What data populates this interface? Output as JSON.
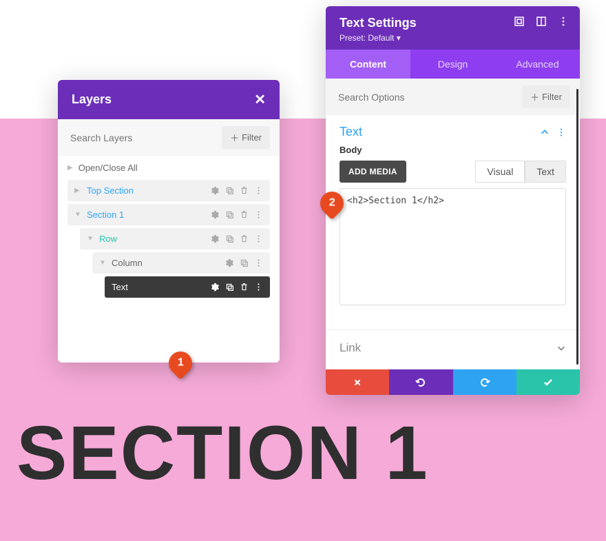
{
  "background": {
    "section_heading": "SECTION 1"
  },
  "layers": {
    "title": "Layers",
    "search_placeholder": "Search Layers",
    "filter_label": "Filter",
    "open_close": "Open/Close All",
    "items": [
      {
        "label": "Top Section"
      },
      {
        "label": "Section 1"
      },
      {
        "label": "Row"
      },
      {
        "label": "Column"
      },
      {
        "label": "Text"
      }
    ]
  },
  "settings": {
    "title": "Text Settings",
    "preset": "Preset: Default",
    "tabs": {
      "content": "Content",
      "design": "Design",
      "advanced": "Advanced"
    },
    "search_placeholder": "Search Options",
    "filter_label": "Filter",
    "text_section": "Text",
    "body_label": "Body",
    "add_media": "ADD MEDIA",
    "editor_tabs": {
      "visual": "Visual",
      "text": "Text"
    },
    "body_content": "<h2>Section 1</h2>",
    "link_section": "Link"
  },
  "callouts": {
    "one": "1",
    "two": "2"
  }
}
